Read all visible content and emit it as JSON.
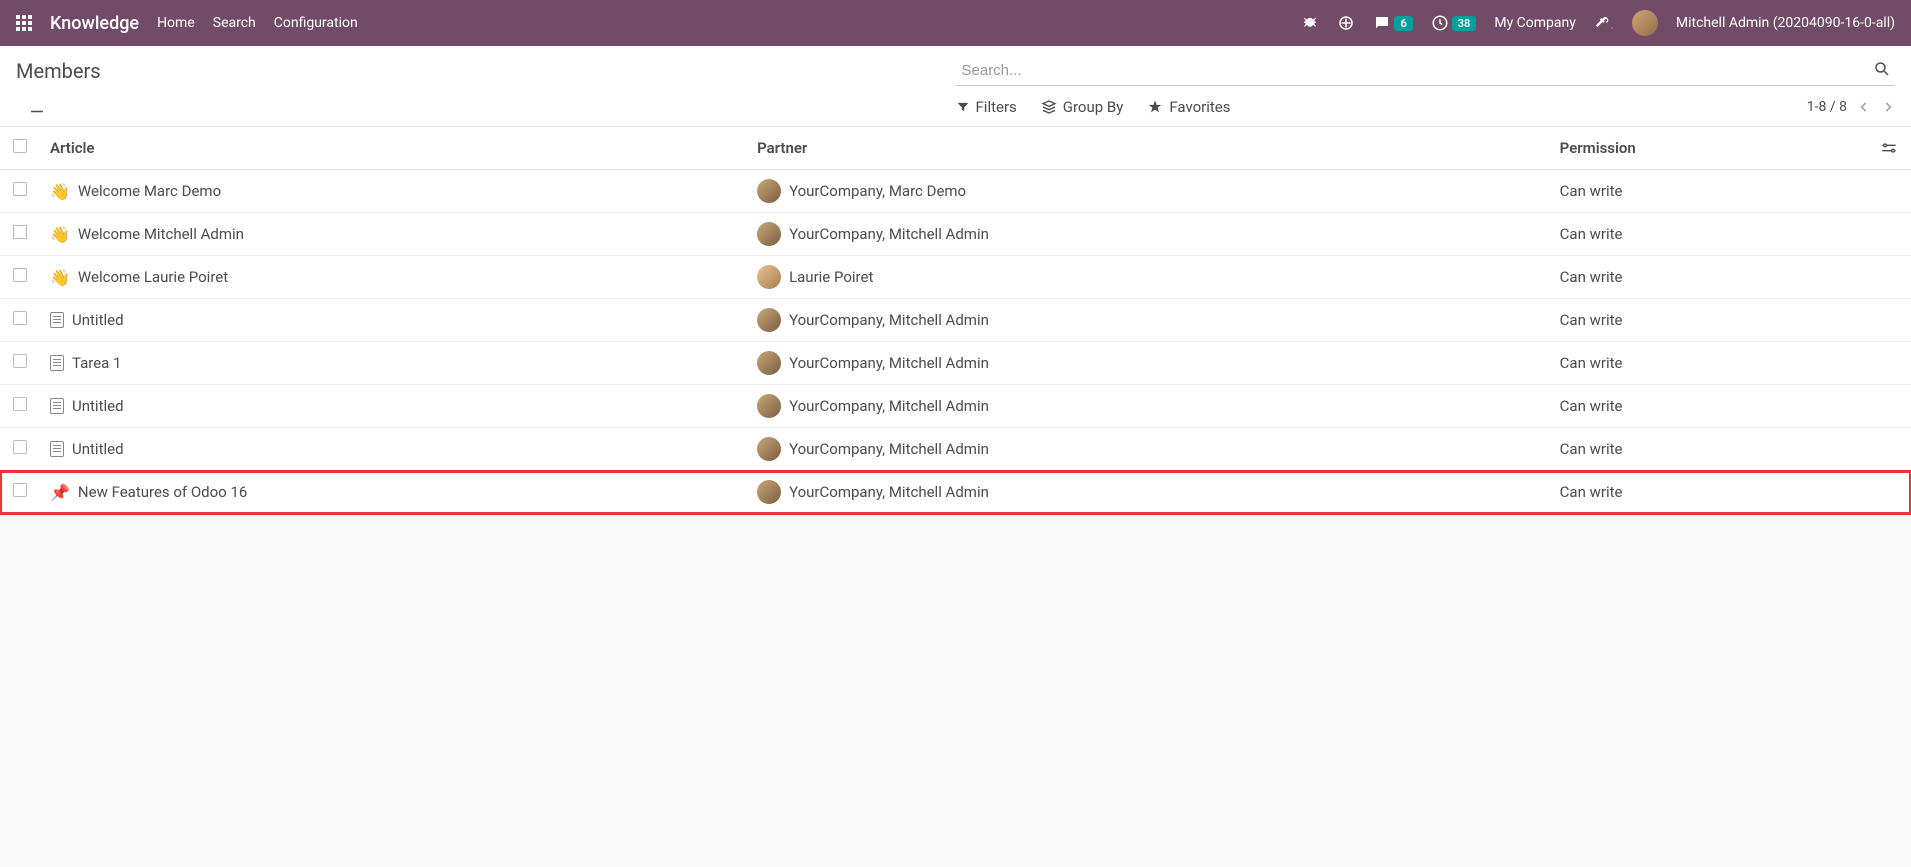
{
  "navbar": {
    "brand": "Knowledge",
    "links": [
      "Home",
      "Search",
      "Configuration"
    ],
    "messages_badge": "6",
    "activities_badge": "38",
    "company": "My Company",
    "user": "Mitchell Admin (20204090-16-0-all)"
  },
  "page": {
    "title": "Members",
    "search_placeholder": "Search...",
    "filters_label": "Filters",
    "groupby_label": "Group By",
    "favorites_label": "Favorites",
    "pager": "1-8 / 8"
  },
  "table": {
    "headers": {
      "article": "Article",
      "partner": "Partner",
      "permission": "Permission"
    },
    "rows": [
      {
        "icon": "wave",
        "article": "Welcome Marc Demo",
        "partner": "YourCompany, Marc Demo",
        "permission": "Can write",
        "highlighted": false
      },
      {
        "icon": "wave",
        "article": "Welcome Mitchell Admin",
        "partner": "YourCompany, Mitchell Admin",
        "permission": "Can write",
        "highlighted": false
      },
      {
        "icon": "wave",
        "article": "Welcome Laurie Poiret",
        "partner": "Laurie Poiret",
        "permission": "Can write",
        "highlighted": false,
        "avatar_class": "laurie"
      },
      {
        "icon": "doc",
        "article": "Untitled",
        "partner": "YourCompany, Mitchell Admin",
        "permission": "Can write",
        "highlighted": false
      },
      {
        "icon": "doc",
        "article": "Tarea 1",
        "partner": "YourCompany, Mitchell Admin",
        "permission": "Can write",
        "highlighted": false
      },
      {
        "icon": "doc",
        "article": "Untitled",
        "partner": "YourCompany, Mitchell Admin",
        "permission": "Can write",
        "highlighted": false
      },
      {
        "icon": "doc",
        "article": "Untitled",
        "partner": "YourCompany, Mitchell Admin",
        "permission": "Can write",
        "highlighted": false
      },
      {
        "icon": "pin",
        "article": "New Features of Odoo 16",
        "partner": "YourCompany, Mitchell Admin",
        "permission": "Can write",
        "highlighted": true
      }
    ]
  }
}
